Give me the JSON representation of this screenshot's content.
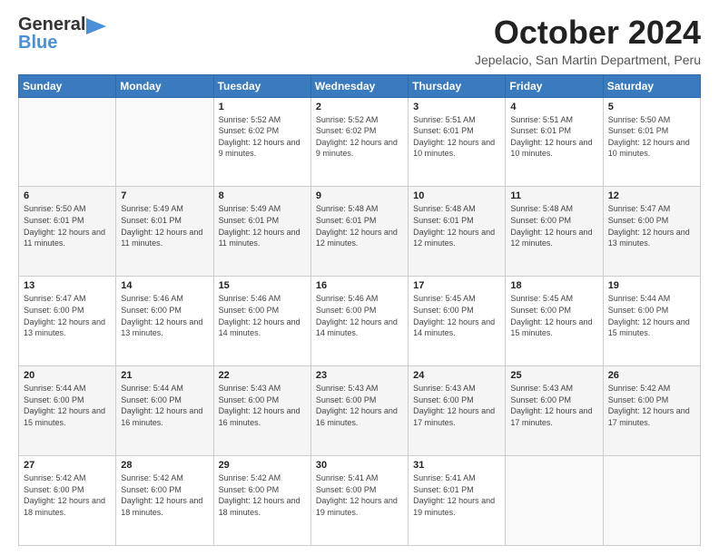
{
  "header": {
    "logo_line1": "General",
    "logo_line2": "Blue",
    "month_title": "October 2024",
    "location": "Jepelacio, San Martin Department, Peru"
  },
  "days_of_week": [
    "Sunday",
    "Monday",
    "Tuesday",
    "Wednesday",
    "Thursday",
    "Friday",
    "Saturday"
  ],
  "weeks": [
    [
      {
        "day": "",
        "info": ""
      },
      {
        "day": "",
        "info": ""
      },
      {
        "day": "1",
        "info": "Sunrise: 5:52 AM\nSunset: 6:02 PM\nDaylight: 12 hours and 9 minutes."
      },
      {
        "day": "2",
        "info": "Sunrise: 5:52 AM\nSunset: 6:02 PM\nDaylight: 12 hours and 9 minutes."
      },
      {
        "day": "3",
        "info": "Sunrise: 5:51 AM\nSunset: 6:01 PM\nDaylight: 12 hours and 10 minutes."
      },
      {
        "day": "4",
        "info": "Sunrise: 5:51 AM\nSunset: 6:01 PM\nDaylight: 12 hours and 10 minutes."
      },
      {
        "day": "5",
        "info": "Sunrise: 5:50 AM\nSunset: 6:01 PM\nDaylight: 12 hours and 10 minutes."
      }
    ],
    [
      {
        "day": "6",
        "info": "Sunrise: 5:50 AM\nSunset: 6:01 PM\nDaylight: 12 hours and 11 minutes."
      },
      {
        "day": "7",
        "info": "Sunrise: 5:49 AM\nSunset: 6:01 PM\nDaylight: 12 hours and 11 minutes."
      },
      {
        "day": "8",
        "info": "Sunrise: 5:49 AM\nSunset: 6:01 PM\nDaylight: 12 hours and 11 minutes."
      },
      {
        "day": "9",
        "info": "Sunrise: 5:48 AM\nSunset: 6:01 PM\nDaylight: 12 hours and 12 minutes."
      },
      {
        "day": "10",
        "info": "Sunrise: 5:48 AM\nSunset: 6:01 PM\nDaylight: 12 hours and 12 minutes."
      },
      {
        "day": "11",
        "info": "Sunrise: 5:48 AM\nSunset: 6:00 PM\nDaylight: 12 hours and 12 minutes."
      },
      {
        "day": "12",
        "info": "Sunrise: 5:47 AM\nSunset: 6:00 PM\nDaylight: 12 hours and 13 minutes."
      }
    ],
    [
      {
        "day": "13",
        "info": "Sunrise: 5:47 AM\nSunset: 6:00 PM\nDaylight: 12 hours and 13 minutes."
      },
      {
        "day": "14",
        "info": "Sunrise: 5:46 AM\nSunset: 6:00 PM\nDaylight: 12 hours and 13 minutes."
      },
      {
        "day": "15",
        "info": "Sunrise: 5:46 AM\nSunset: 6:00 PM\nDaylight: 12 hours and 14 minutes."
      },
      {
        "day": "16",
        "info": "Sunrise: 5:46 AM\nSunset: 6:00 PM\nDaylight: 12 hours and 14 minutes."
      },
      {
        "day": "17",
        "info": "Sunrise: 5:45 AM\nSunset: 6:00 PM\nDaylight: 12 hours and 14 minutes."
      },
      {
        "day": "18",
        "info": "Sunrise: 5:45 AM\nSunset: 6:00 PM\nDaylight: 12 hours and 15 minutes."
      },
      {
        "day": "19",
        "info": "Sunrise: 5:44 AM\nSunset: 6:00 PM\nDaylight: 12 hours and 15 minutes."
      }
    ],
    [
      {
        "day": "20",
        "info": "Sunrise: 5:44 AM\nSunset: 6:00 PM\nDaylight: 12 hours and 15 minutes."
      },
      {
        "day": "21",
        "info": "Sunrise: 5:44 AM\nSunset: 6:00 PM\nDaylight: 12 hours and 16 minutes."
      },
      {
        "day": "22",
        "info": "Sunrise: 5:43 AM\nSunset: 6:00 PM\nDaylight: 12 hours and 16 minutes."
      },
      {
        "day": "23",
        "info": "Sunrise: 5:43 AM\nSunset: 6:00 PM\nDaylight: 12 hours and 16 minutes."
      },
      {
        "day": "24",
        "info": "Sunrise: 5:43 AM\nSunset: 6:00 PM\nDaylight: 12 hours and 17 minutes."
      },
      {
        "day": "25",
        "info": "Sunrise: 5:43 AM\nSunset: 6:00 PM\nDaylight: 12 hours and 17 minutes."
      },
      {
        "day": "26",
        "info": "Sunrise: 5:42 AM\nSunset: 6:00 PM\nDaylight: 12 hours and 17 minutes."
      }
    ],
    [
      {
        "day": "27",
        "info": "Sunrise: 5:42 AM\nSunset: 6:00 PM\nDaylight: 12 hours and 18 minutes."
      },
      {
        "day": "28",
        "info": "Sunrise: 5:42 AM\nSunset: 6:00 PM\nDaylight: 12 hours and 18 minutes."
      },
      {
        "day": "29",
        "info": "Sunrise: 5:42 AM\nSunset: 6:00 PM\nDaylight: 12 hours and 18 minutes."
      },
      {
        "day": "30",
        "info": "Sunrise: 5:41 AM\nSunset: 6:00 PM\nDaylight: 12 hours and 19 minutes."
      },
      {
        "day": "31",
        "info": "Sunrise: 5:41 AM\nSunset: 6:01 PM\nDaylight: 12 hours and 19 minutes."
      },
      {
        "day": "",
        "info": ""
      },
      {
        "day": "",
        "info": ""
      }
    ]
  ]
}
